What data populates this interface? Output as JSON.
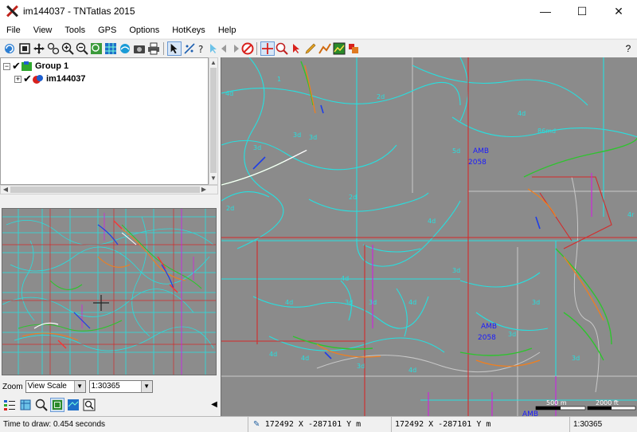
{
  "window": {
    "title": "im144037 - TNTatlas 2015",
    "minimize_glyph": "—",
    "maximize_glyph": "☐",
    "close_glyph": "✕"
  },
  "menu": {
    "items": [
      "File",
      "View",
      "Tools",
      "GPS",
      "Options",
      "HotKeys",
      "Help"
    ]
  },
  "toolbar": {
    "help_glyph": "?"
  },
  "layers": {
    "group_expander": "−",
    "layer_expander": "+",
    "group_label": "Group 1",
    "layer_label": "im144037"
  },
  "zoom": {
    "label": "Zoom",
    "mode": "View Scale",
    "scale": "1:30365"
  },
  "map": {
    "labels": [
      {
        "text": "AMB",
        "color": "#1a1aff"
      },
      {
        "text": "2058",
        "color": "#1a1aff"
      },
      {
        "text": "AMB",
        "color": "#1a1aff"
      },
      {
        "text": "2058",
        "color": "#1a1aff"
      },
      {
        "text": "AMB",
        "color": "#1a1aff"
      }
    ],
    "scale_bar_1": "500 m",
    "scale_bar_2": "2000 ft"
  },
  "status": {
    "draw_time": "Time to draw: 0.454 seconds",
    "coords_1": "172492 X  -287101 Y m",
    "coords_2": "172492 X  -287101 Y m",
    "scale": "1:30365"
  },
  "colors": {
    "contour": "#26e0e0",
    "grid_red": "#d42a2a",
    "grid_magenta": "#d21ee0",
    "road": "#c8c8c8",
    "map_bg": "#8b8b8b"
  }
}
